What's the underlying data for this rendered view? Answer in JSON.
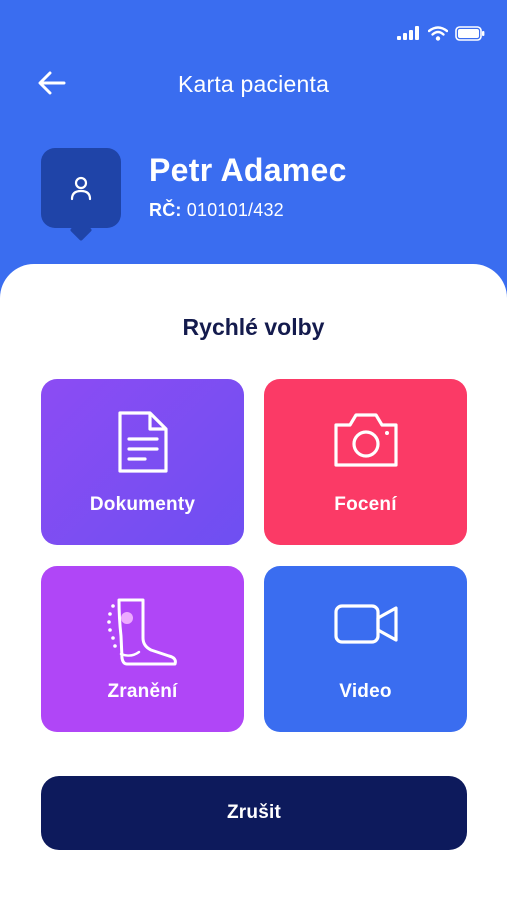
{
  "header": {
    "title": "Karta pacienta",
    "back_icon": "arrow-left-icon"
  },
  "status_bar": {
    "icons": [
      "signal-icon",
      "wifi-icon",
      "battery-icon"
    ]
  },
  "patient": {
    "name": "Petr Adamec",
    "id_label": "RČ:",
    "id_value": "010101/432",
    "avatar_icon": "user-icon"
  },
  "quick_actions": {
    "title": "Rychlé volby",
    "tiles": [
      {
        "label": "Dokumenty",
        "icon": "document-icon",
        "color": "#7d4ef2"
      },
      {
        "label": "Focení",
        "icon": "camera-icon",
        "color": "#fb3a66"
      },
      {
        "label": "Zranění",
        "icon": "leg-injury-icon",
        "color": "#b046f7"
      },
      {
        "label": "Video",
        "icon": "video-camera-icon",
        "color": "#3a6df0"
      }
    ]
  },
  "cancel_label": "Zrušit",
  "colors": {
    "header": "#3a6df0",
    "title_text": "#141b4d",
    "cancel_button": "#0d1a5c",
    "avatar": "#1f44a8"
  }
}
